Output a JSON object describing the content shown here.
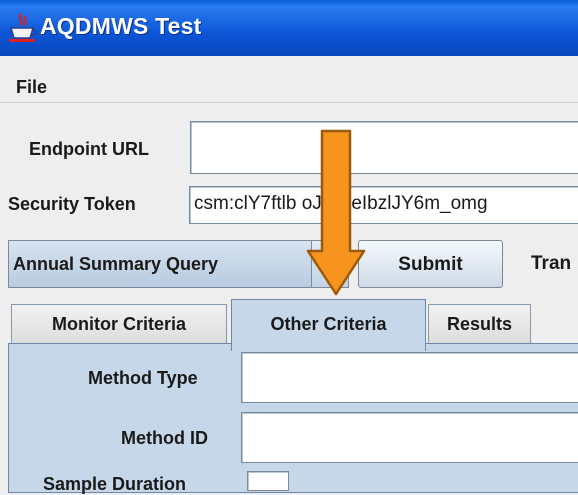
{
  "window": {
    "title": "AQDMWS Test",
    "icon": "java-cup-icon"
  },
  "menu": {
    "items": [
      {
        "label": "File"
      }
    ]
  },
  "form": {
    "endpoint_url": {
      "label": "Endpoint URL",
      "value": ""
    },
    "security_token": {
      "label": "Security Token",
      "value": "csm:clY7ftlb  oJR4IeIbzlJY6m_omg"
    }
  },
  "query": {
    "type_selected": "Annual Summary Query",
    "submit_label": "Submit",
    "trailing_label": "Tran"
  },
  "tabs": [
    {
      "label": "Monitor Criteria",
      "selected": false
    },
    {
      "label": "Other Criteria",
      "selected": true
    },
    {
      "label": "Results",
      "selected": false
    }
  ],
  "other_criteria": {
    "method_type": {
      "label": "Method Type",
      "value": ""
    },
    "method_id": {
      "label": "Method ID",
      "value": ""
    },
    "sample_duration": {
      "label": "Sample Duration",
      "value": ""
    }
  },
  "colors": {
    "titlebar": "#0b55d6",
    "arrow": "#f7941d",
    "selected_tab": "#c7d7ea"
  }
}
